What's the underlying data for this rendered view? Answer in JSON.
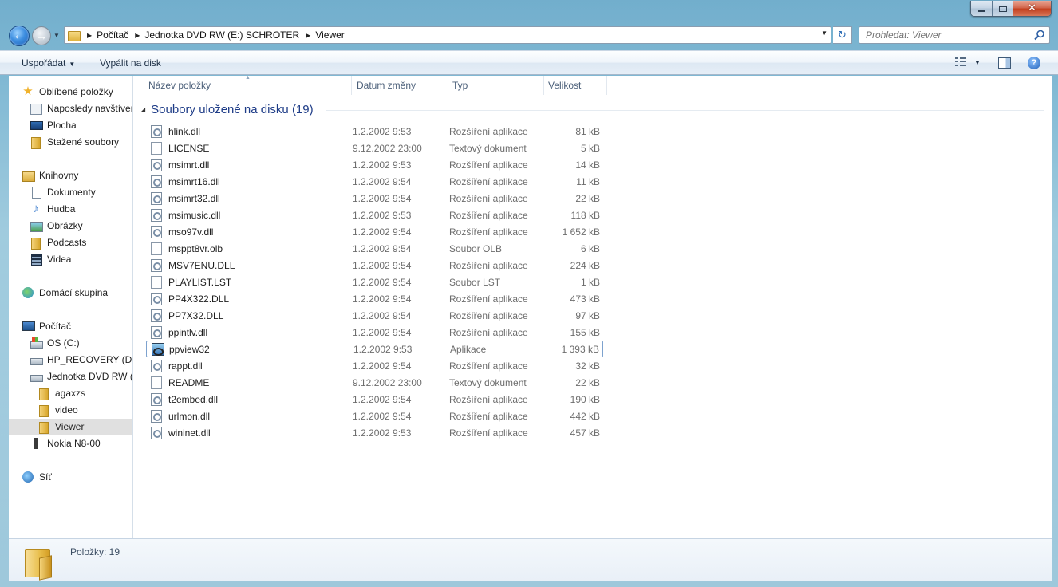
{
  "window": {
    "close_glyph": "✕"
  },
  "address": {
    "breadcrumbs": [
      "Počítač",
      "Jednotka DVD RW (E:) SCHROTER",
      "Viewer"
    ]
  },
  "search": {
    "placeholder": "Prohledat: Viewer"
  },
  "toolbar": {
    "organize_label": "Uspořádat",
    "burn_label": "Vypálit na disk"
  },
  "sidebar": {
    "items": [
      {
        "label": "Oblíbené položky",
        "icon": "star-icon",
        "indent": 0,
        "selected": false
      },
      {
        "label": "Naposledy navštívené",
        "icon": "recent-places-icon",
        "indent": 1,
        "selected": false
      },
      {
        "label": "Plocha",
        "icon": "desktop-icon",
        "indent": 1,
        "selected": false
      },
      {
        "label": "Stažené soubory",
        "icon": "downloads-folder-icon",
        "indent": 1,
        "selected": false
      },
      {
        "label": "Knihovny",
        "icon": "libraries-icon",
        "indent": 0,
        "selected": false
      },
      {
        "label": "Dokumenty",
        "icon": "documents-icon",
        "indent": 1,
        "selected": false
      },
      {
        "label": "Hudba",
        "icon": "music-icon",
        "indent": 1,
        "selected": false
      },
      {
        "label": "Obrázky",
        "icon": "pictures-icon",
        "indent": 1,
        "selected": false
      },
      {
        "label": "Podcasts",
        "icon": "folder-icon",
        "indent": 1,
        "selected": false
      },
      {
        "label": "Videa",
        "icon": "videos-icon",
        "indent": 1,
        "selected": false
      },
      {
        "label": "Domácí skupina",
        "icon": "homegroup-icon",
        "indent": 0,
        "selected": false
      },
      {
        "label": "Počítač",
        "icon": "computer-icon",
        "indent": 0,
        "selected": false
      },
      {
        "label": "OS (C:)",
        "icon": "os-drive-icon",
        "indent": 1,
        "selected": false
      },
      {
        "label": "HP_RECOVERY (D:)",
        "icon": "drive-icon",
        "indent": 1,
        "selected": false
      },
      {
        "label": "Jednotka DVD RW (E:) SCHROTER",
        "icon": "dvd-drive-icon",
        "indent": 1,
        "selected": false
      },
      {
        "label": "agaxzs",
        "icon": "folder-icon",
        "indent": 2,
        "selected": false
      },
      {
        "label": "video",
        "icon": "folder-icon",
        "indent": 2,
        "selected": false
      },
      {
        "label": "Viewer",
        "icon": "folder-icon",
        "indent": 2,
        "selected": true
      },
      {
        "label": "Nokia N8-00",
        "icon": "phone-icon",
        "indent": 1,
        "selected": false
      },
      {
        "label": "Síť",
        "icon": "network-icon",
        "indent": 0,
        "selected": false
      }
    ]
  },
  "columns": {
    "name": "Název položky",
    "date": "Datum změny",
    "type": "Typ",
    "size": "Velikost"
  },
  "group": {
    "title": "Soubory uložené na disku (19)"
  },
  "files": [
    {
      "name": "hlink.dll",
      "date": "1.2.2002 9:53",
      "type": "Rozšíření aplikace",
      "size": "81 kB",
      "icon": "dll"
    },
    {
      "name": "LICENSE",
      "date": "9.12.2002 23:00",
      "type": "Textový dokument",
      "size": "5 kB",
      "icon": "doc"
    },
    {
      "name": "msimrt.dll",
      "date": "1.2.2002 9:53",
      "type": "Rozšíření aplikace",
      "size": "14 kB",
      "icon": "dll"
    },
    {
      "name": "msimrt16.dll",
      "date": "1.2.2002 9:54",
      "type": "Rozšíření aplikace",
      "size": "11 kB",
      "icon": "dll"
    },
    {
      "name": "msimrt32.dll",
      "date": "1.2.2002 9:54",
      "type": "Rozšíření aplikace",
      "size": "22 kB",
      "icon": "dll"
    },
    {
      "name": "msimusic.dll",
      "date": "1.2.2002 9:53",
      "type": "Rozšíření aplikace",
      "size": "118 kB",
      "icon": "dll"
    },
    {
      "name": "mso97v.dll",
      "date": "1.2.2002 9:54",
      "type": "Rozšíření aplikace",
      "size": "1 652 kB",
      "icon": "dll"
    },
    {
      "name": "msppt8vr.olb",
      "date": "1.2.2002 9:54",
      "type": "Soubor OLB",
      "size": "6 kB",
      "icon": "doc"
    },
    {
      "name": "MSV7ENU.DLL",
      "date": "1.2.2002 9:54",
      "type": "Rozšíření aplikace",
      "size": "224 kB",
      "icon": "dll"
    },
    {
      "name": "PLAYLIST.LST",
      "date": "1.2.2002 9:54",
      "type": "Soubor LST",
      "size": "1 kB",
      "icon": "doc"
    },
    {
      "name": "PP4X322.DLL",
      "date": "1.2.2002 9:54",
      "type": "Rozšíření aplikace",
      "size": "473 kB",
      "icon": "dll"
    },
    {
      "name": "PP7X32.DLL",
      "date": "1.2.2002 9:54",
      "type": "Rozšíření aplikace",
      "size": "97 kB",
      "icon": "dll"
    },
    {
      "name": "ppintlv.dll",
      "date": "1.2.2002 9:54",
      "type": "Rozšíření aplikace",
      "size": "155 kB",
      "icon": "dll"
    },
    {
      "name": "ppview32",
      "date": "1.2.2002 9:53",
      "type": "Aplikace",
      "size": "1 393 kB",
      "icon": "app",
      "focused": true
    },
    {
      "name": "rappt.dll",
      "date": "1.2.2002 9:54",
      "type": "Rozšíření aplikace",
      "size": "32 kB",
      "icon": "dll"
    },
    {
      "name": "README",
      "date": "9.12.2002 23:00",
      "type": "Textový dokument",
      "size": "22 kB",
      "icon": "doc"
    },
    {
      "name": "t2embed.dll",
      "date": "1.2.2002 9:54",
      "type": "Rozšíření aplikace",
      "size": "190 kB",
      "icon": "dll"
    },
    {
      "name": "urlmon.dll",
      "date": "1.2.2002 9:54",
      "type": "Rozšíření aplikace",
      "size": "442 kB",
      "icon": "dll"
    },
    {
      "name": "wininet.dll",
      "date": "1.2.2002 9:53",
      "type": "Rozšíření aplikace",
      "size": "457 kB",
      "icon": "dll"
    }
  ],
  "details": {
    "count_text": "Položky: 19"
  }
}
